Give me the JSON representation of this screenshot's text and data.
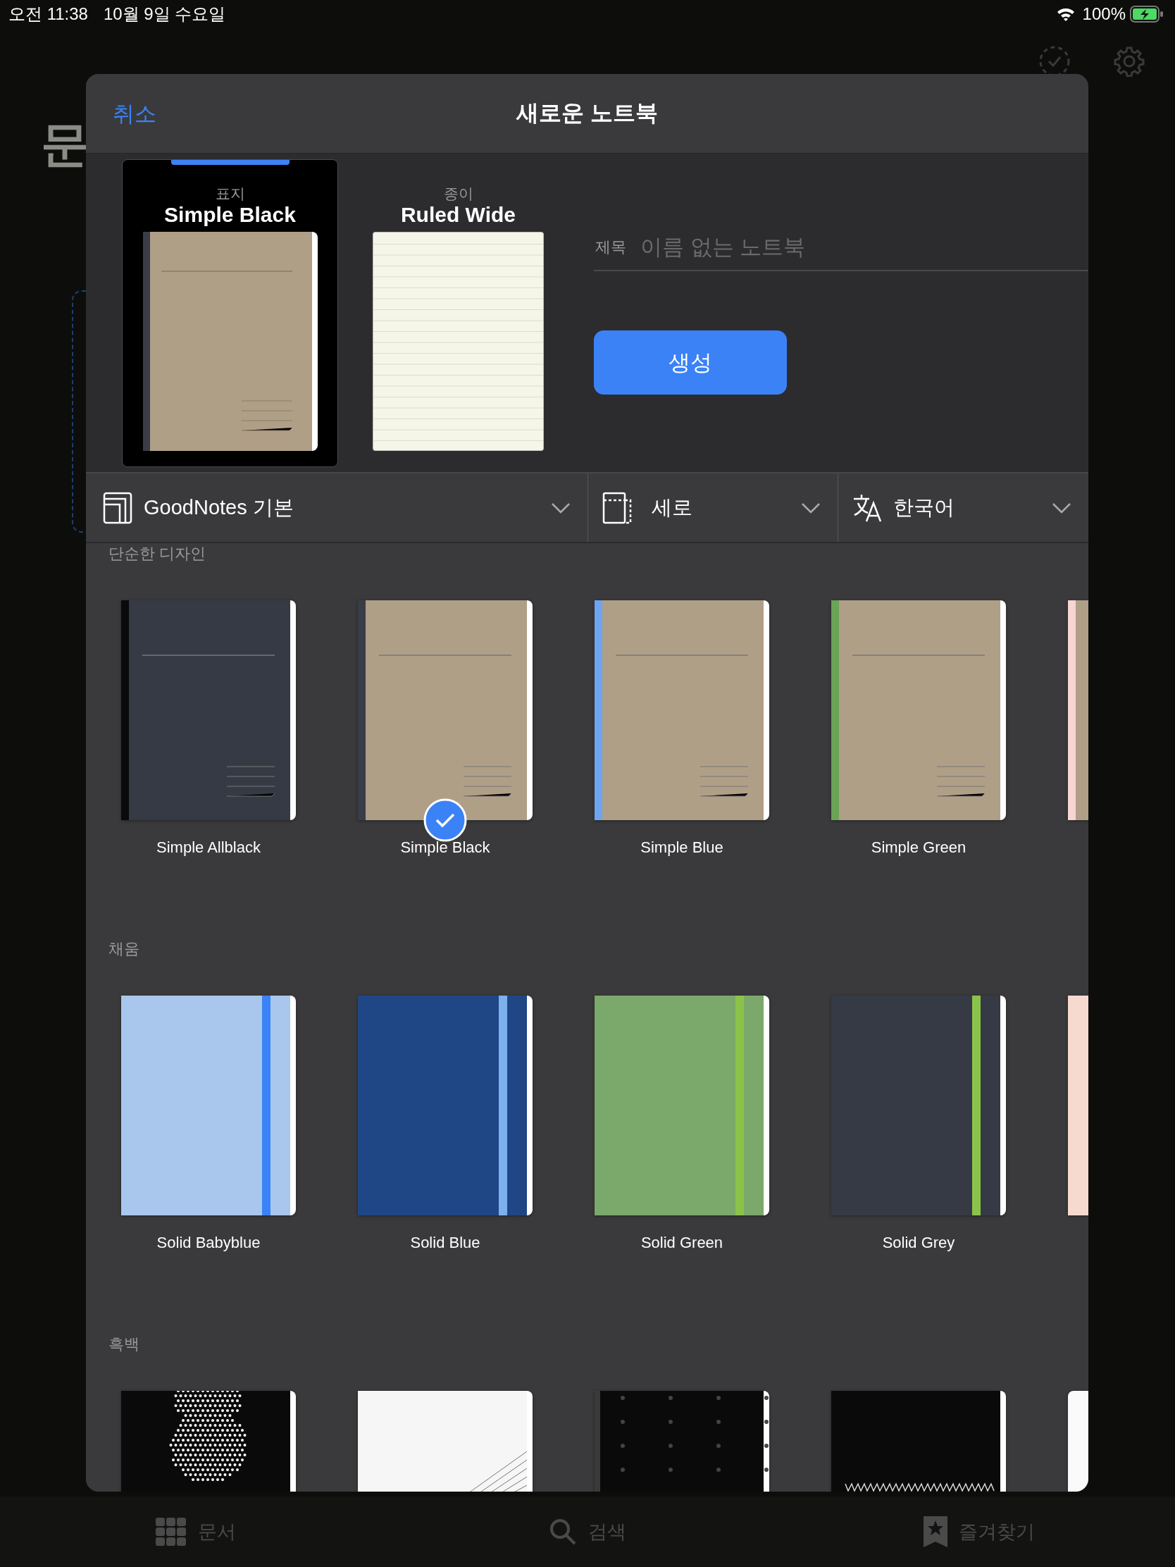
{
  "status_bar": {
    "time": "오전 11:38",
    "date": "10월 9일 수요일",
    "battery": "100%"
  },
  "background": {
    "title": "문",
    "tabs": [
      {
        "kind": "documents",
        "label": "문서"
      },
      {
        "kind": "search",
        "label": "검색"
      },
      {
        "kind": "favorites",
        "label": "즐겨찾기"
      }
    ]
  },
  "dialog": {
    "cancel": "취소",
    "title": "새로운 노트북",
    "cover": {
      "caption": "표지",
      "name": "Simple Black",
      "selected": true
    },
    "paper": {
      "caption": "종이",
      "name": "Ruled Wide",
      "selected": false
    },
    "title_field": {
      "label": "제목",
      "placeholder": "이름 없는 노트북"
    },
    "create_button": "생성",
    "dropdowns": [
      {
        "kind": "template",
        "label": "GoodNotes 기본"
      },
      {
        "kind": "orientation",
        "label": "세로"
      },
      {
        "kind": "language",
        "label": "한국어"
      }
    ],
    "sections": [
      {
        "title": "단순한 디자인",
        "covers": [
          {
            "kind": "simple",
            "name": "Simple Allblack",
            "color": "#363a45",
            "spine": {
              "color": "#0a0a0a"
            },
            "selected": false
          },
          {
            "kind": "simple",
            "name": "Simple Black",
            "color": "#b09f87",
            "spine": {
              "color": "#3a3d47"
            },
            "selected": true
          },
          {
            "kind": "simple",
            "name": "Simple Blue",
            "color": "#b09f87",
            "spine": {
              "color": "#6fa4f0"
            },
            "selected": false
          },
          {
            "kind": "simple",
            "name": "Simple Green",
            "color": "#b09f87",
            "spine": {
              "color": "#6aa456"
            },
            "selected": false
          },
          {
            "kind": "simple",
            "color": "#b09f87",
            "spine": {
              "color": "#f6d5d2"
            }
          }
        ]
      },
      {
        "title": "채움",
        "covers": [
          {
            "kind": "solid",
            "name": "Solid Babyblue",
            "color": "#a9c6ec",
            "spine": {
              "color": "#3b82f6"
            },
            "selected": false
          },
          {
            "kind": "solid",
            "name": "Solid Blue",
            "color": "#1f4785",
            "spine": {
              "color": "#7fb0ee"
            },
            "selected": false
          },
          {
            "kind": "solid",
            "name": "Solid Green",
            "color": "#7ba86b",
            "spine": {
              "color": "#8bc34a"
            },
            "selected": false
          },
          {
            "kind": "solid",
            "name": "Solid Grey",
            "color": "#363a45",
            "spine": {
              "color": "#8bc34a"
            },
            "selected": false
          },
          {
            "kind": "solid",
            "color": "#f6dad0",
            "spine": {
              "color": "#f6dad0"
            }
          }
        ]
      },
      {
        "title": "흑백",
        "covers": [
          {
            "kind": "halftone"
          },
          {
            "kind": "diagonal"
          },
          {
            "kind": "pattern"
          },
          {
            "kind": "zigzag"
          },
          {
            "kind": "blank"
          }
        ]
      }
    ]
  }
}
